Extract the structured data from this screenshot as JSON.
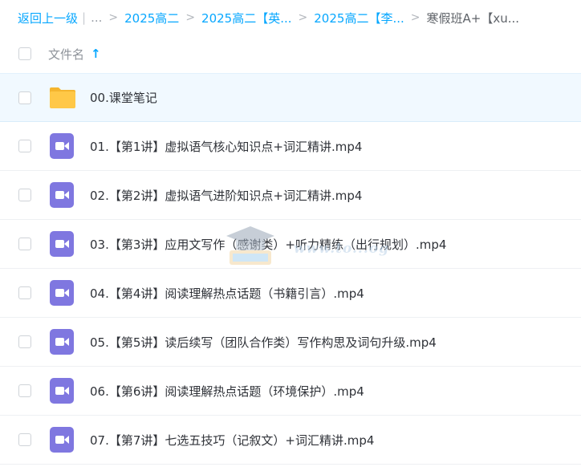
{
  "breadcrumb": {
    "back_label": "返回上一级",
    "ellipsis": "...",
    "items": [
      "2025高二",
      "2025高二【英...",
      "2025高二【李...",
      "寒假班A+【xu..."
    ]
  },
  "header": {
    "column_label": "文件名",
    "sort_icon": "sort-ascending-icon"
  },
  "files": [
    {
      "name": "00.课堂笔记",
      "type": "folder",
      "icon": "folder-icon"
    },
    {
      "name": "01.【第1讲】虚拟语气核心知识点+词汇精讲.mp4",
      "type": "video",
      "icon": "video-file-icon"
    },
    {
      "name": "02.【第2讲】虚拟语气进阶知识点+词汇精讲.mp4",
      "type": "video",
      "icon": "video-file-icon"
    },
    {
      "name": "03.【第3讲】应用文写作（感谢类）+听力精练（出行规划）.mp4",
      "type": "video",
      "icon": "video-file-icon"
    },
    {
      "name": "04.【第4讲】阅读理解热点话题（书籍引言）.mp4",
      "type": "video",
      "icon": "video-file-icon"
    },
    {
      "name": "05.【第5讲】读后续写（团队合作类）写作构思及词句升级.mp4",
      "type": "video",
      "icon": "video-file-icon"
    },
    {
      "name": "06.【第6讲】阅读理解热点话题（环境保护）.mp4",
      "type": "video",
      "icon": "video-file-icon"
    },
    {
      "name": "07.【第7讲】七选五技巧（记叙文）+词汇精讲.mp4",
      "type": "video",
      "icon": "video-file-icon"
    }
  ],
  "watermark": {
    "text": "www.to...og"
  },
  "colors": {
    "link": "#06a7ff",
    "folder": "#ffc847",
    "video": "#7f77e0",
    "selected_row": "#f1f9ff"
  }
}
